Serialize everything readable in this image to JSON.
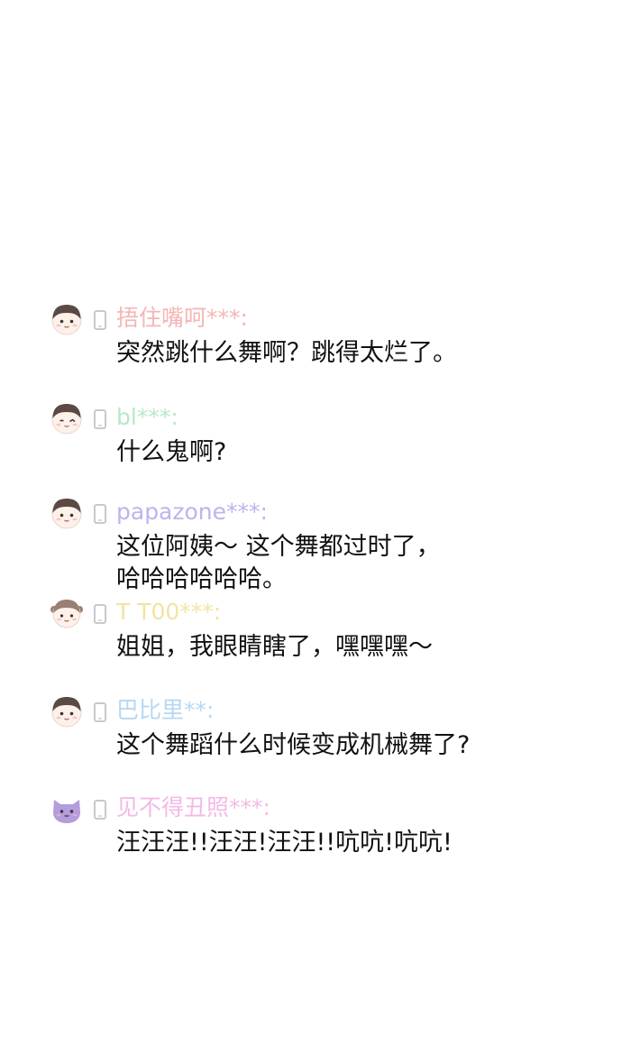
{
  "comments": [
    {
      "username": "捂住嘴呵***:",
      "username_color": "#f5b5b5",
      "text": "突然跳什么舞啊？跳得太烂了。",
      "avatar": "boy-face-icon"
    },
    {
      "username": "bl***:",
      "username_color": "#b8e8c8",
      "text": "什么鬼啊?",
      "avatar": "winking-face-icon"
    },
    {
      "username": "papazone***:",
      "username_color": "#b9b6ee",
      "text": "这位阿姨～ 这个舞都过时了，\n哈哈哈哈哈哈。",
      "avatar": "boy-face-icon"
    },
    {
      "username": "T T00***:",
      "username_color": "#f3e3a2",
      "text": "姐姐，我眼睛瞎了，嘿嘿嘿～",
      "avatar": "pigtail-girl-icon"
    },
    {
      "username": "巴比里**:",
      "username_color": "#b6d7f2",
      "text": "这个舞蹈什么时候变成机械舞了?",
      "avatar": "boy-face-icon"
    },
    {
      "username": "见不得丑照***:",
      "username_color": "#f3b9e5",
      "text": "汪汪汪!!汪汪!汪汪!!吭吭!吭吭!",
      "avatar": "purple-cat-icon"
    }
  ]
}
